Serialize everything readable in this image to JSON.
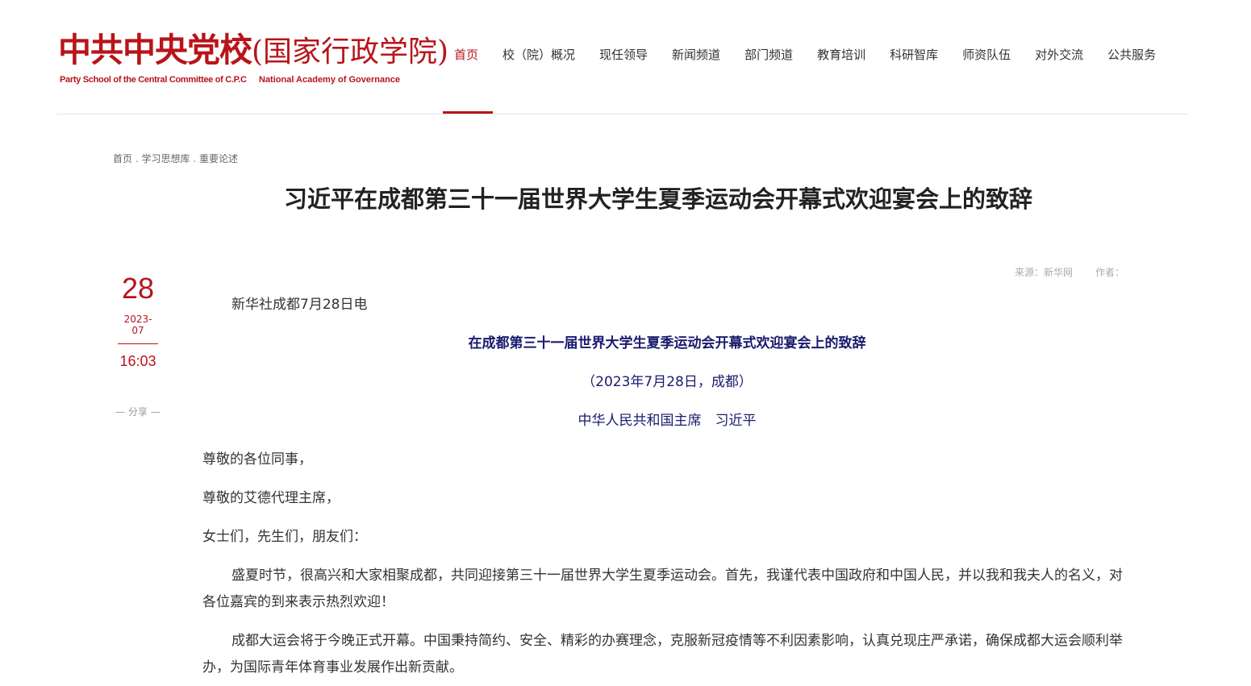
{
  "logo": {
    "cn_main": "中共中央党校",
    "cn_paren": "(国家行政学院)",
    "en_left": "Party School of the Central Committee of C.P.C",
    "en_right": "National Academy of Governance"
  },
  "nav": {
    "items": [
      {
        "label": "首页",
        "active": true
      },
      {
        "label": "校（院）概况"
      },
      {
        "label": "现任领导"
      },
      {
        "label": "新闻频道"
      },
      {
        "label": "部门频道"
      },
      {
        "label": "教育培训"
      },
      {
        "label": "科研智库"
      },
      {
        "label": "师资队伍"
      },
      {
        "label": "对外交流"
      },
      {
        "label": "公共服务"
      }
    ]
  },
  "breadcrumb": {
    "home": "首页",
    "level2": "学习思想库",
    "level3": "重要论述",
    "separator": " . "
  },
  "article": {
    "title": "习近平在成都第三十一届世界大学生夏季运动会开幕式欢迎宴会上的致辞",
    "source": "来源：新华网",
    "author": "作者：",
    "date": {
      "day": "28",
      "year_month": "2023-07",
      "time": "16:03"
    },
    "share": "— 分享 —",
    "paragraphs": {
      "dateline": "新华社成都7月28日电",
      "heading": "在成都第三十一届世界大学生夏季运动会开幕式欢迎宴会上的致辞",
      "sub_date": "（2023年7月28日，成都）",
      "speaker": "中华人民共和国主席　习近平",
      "greeting1": "尊敬的各位同事，",
      "greeting2": "尊敬的艾德代理主席，",
      "greeting3": "女士们，先生们，朋友们：",
      "body1": "盛夏时节，很高兴和大家相聚成都，共同迎接第三十一届世界大学生夏季运动会。首先，我谨代表中国政府和中国人民，并以我和我夫人的名义，对各位嘉宾的到来表示热烈欢迎！",
      "body2": "成都大运会将于今晚正式开幕。中国秉持简约、安全、精彩的办赛理念，克服新冠疫情等不利因素影响，认真兑现庄严承诺，确保成都大运会顺利举办，为国际青年体育事业发展作出新贡献。"
    }
  },
  "colors": {
    "brand_red": "#b8141a",
    "heading_blue": "#1a1a6e",
    "text": "#333333"
  }
}
